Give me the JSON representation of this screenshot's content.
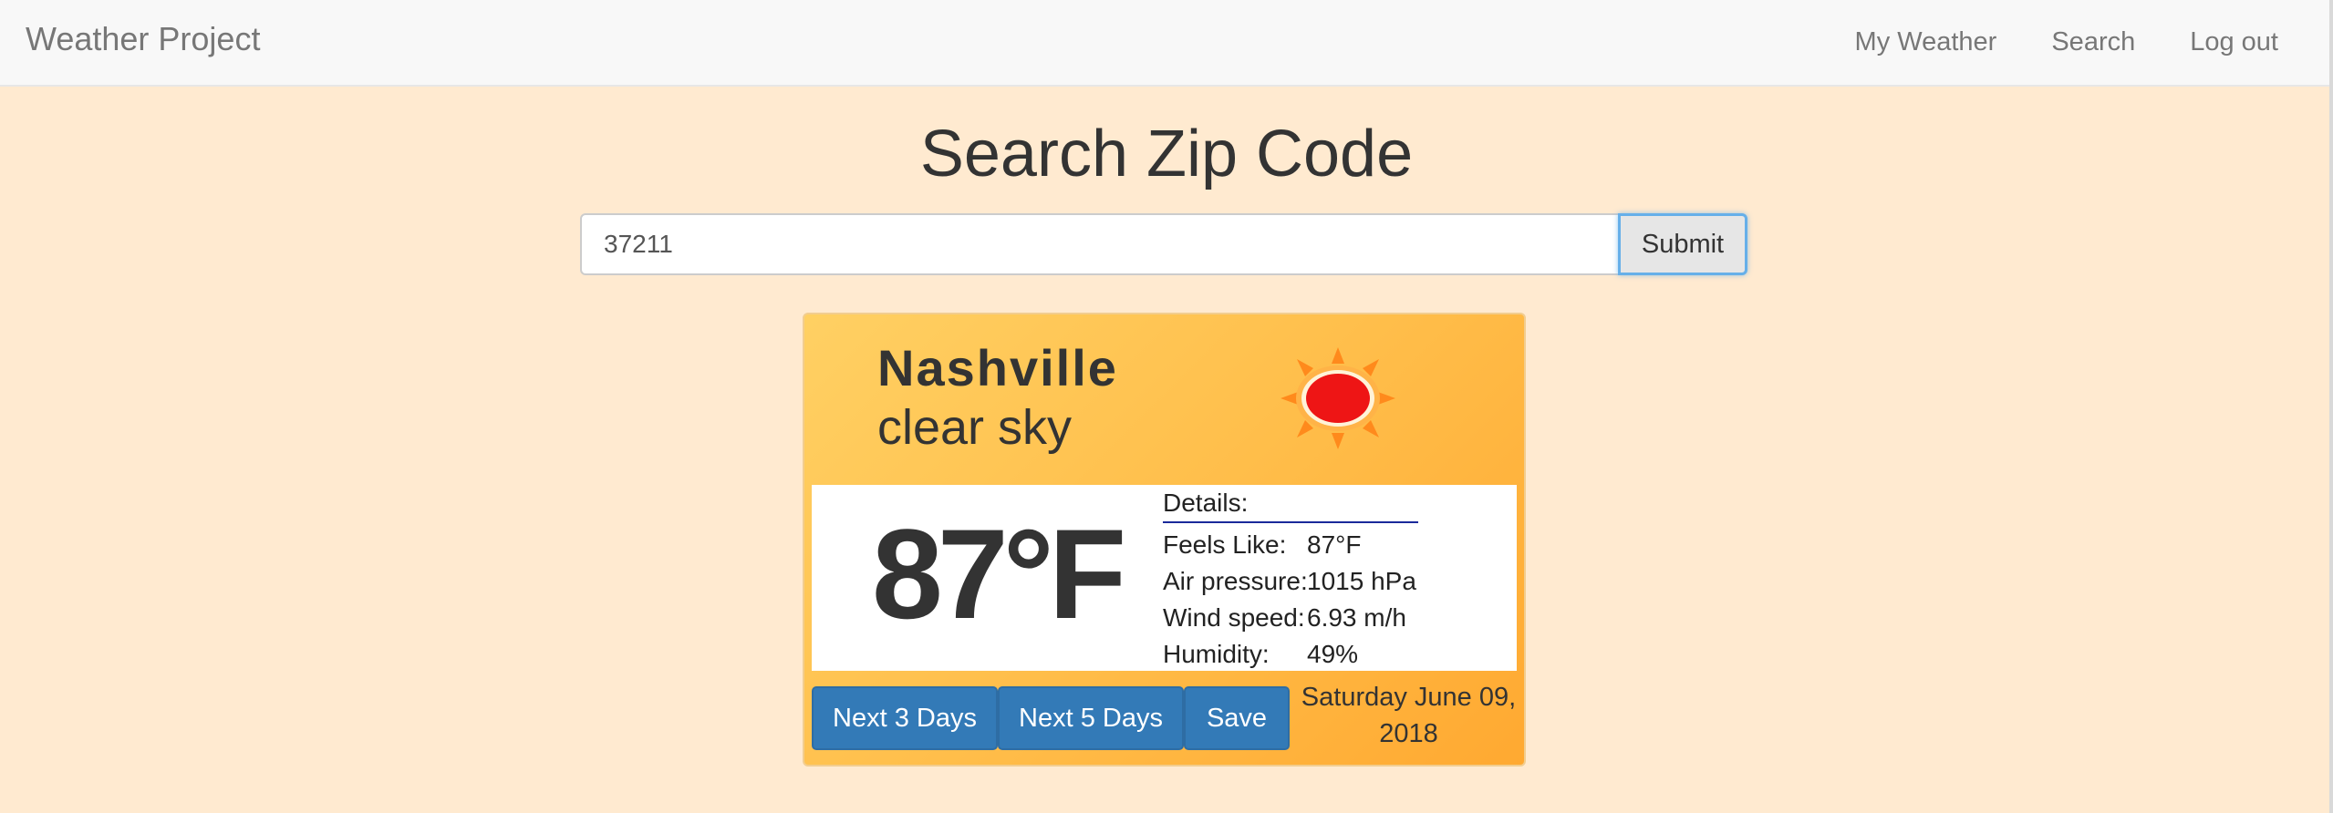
{
  "navbar": {
    "brand": "Weather Project",
    "links": [
      "My Weather",
      "Search",
      "Log out"
    ]
  },
  "search": {
    "title": "Search Zip Code",
    "input_value": "37211",
    "submit_label": "Submit"
  },
  "weather": {
    "city": "Nashville",
    "condition": "clear sky",
    "icon": "sun-icon",
    "temperature": "87°F",
    "details_title": "Details:",
    "details": [
      {
        "label": "Feels Like:",
        "value": "87°F"
      },
      {
        "label": "Air pressure:",
        "value": "1015 hPa"
      },
      {
        "label": "Wind speed:",
        "value": "6.93 m/h"
      },
      {
        "label": "Humidity:",
        "value": "49%"
      }
    ],
    "buttons": {
      "next3": "Next 3 Days",
      "next5": "Next 5 Days",
      "save": "Save"
    },
    "date": "Saturday June 09, 2018"
  },
  "colors": {
    "page_background": "#ffead0",
    "navbar_background": "#f8f8f8",
    "card_gradient_start": "#ffd063",
    "card_gradient_end": "#ffa931",
    "button_primary": "#337ab7",
    "sun_core": "#ee1515",
    "sun_rays": "#ff8a1c"
  }
}
